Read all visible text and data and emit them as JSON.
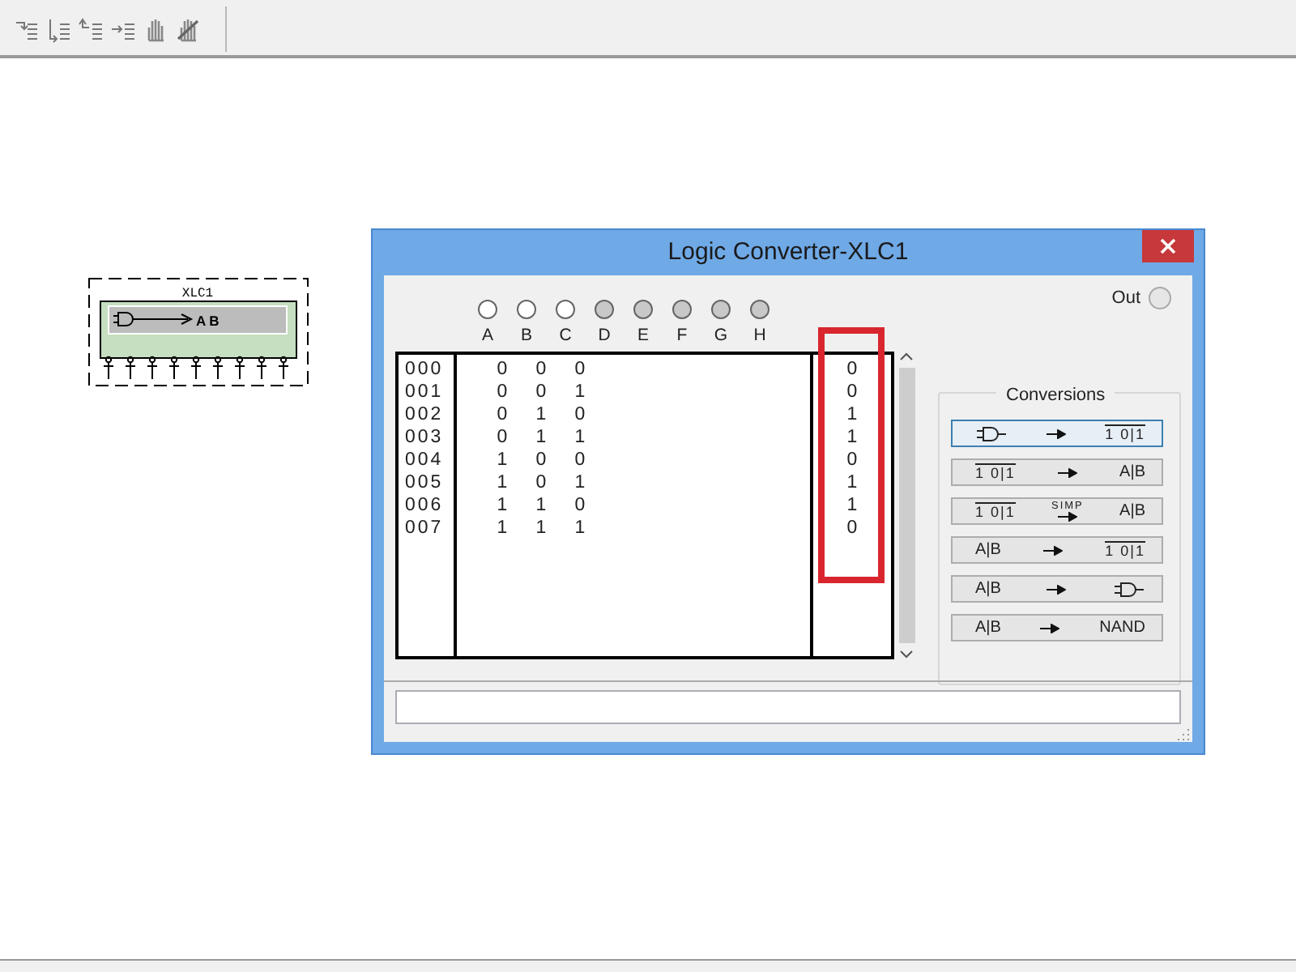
{
  "component": {
    "label": "XLC1",
    "symbol_text": "A B"
  },
  "window": {
    "title": "Logic Converter-XLC1",
    "out_label": "Out",
    "inputs": [
      {
        "label": "A",
        "active": true
      },
      {
        "label": "B",
        "active": true
      },
      {
        "label": "C",
        "active": true
      },
      {
        "label": "D",
        "active": false
      },
      {
        "label": "E",
        "active": false
      },
      {
        "label": "F",
        "active": false
      },
      {
        "label": "G",
        "active": false
      },
      {
        "label": "H",
        "active": false
      }
    ],
    "rows": [
      {
        "index": "000",
        "values": [
          "0",
          "0",
          "0"
        ],
        "output": "0"
      },
      {
        "index": "001",
        "values": [
          "0",
          "0",
          "1"
        ],
        "output": "0"
      },
      {
        "index": "002",
        "values": [
          "0",
          "1",
          "0"
        ],
        "output": "1"
      },
      {
        "index": "003",
        "values": [
          "0",
          "1",
          "1"
        ],
        "output": "1"
      },
      {
        "index": "004",
        "values": [
          "1",
          "0",
          "0"
        ],
        "output": "0"
      },
      {
        "index": "005",
        "values": [
          "1",
          "0",
          "1"
        ],
        "output": "1"
      },
      {
        "index": "006",
        "values": [
          "1",
          "1",
          "0"
        ],
        "output": "1"
      },
      {
        "index": "007",
        "values": [
          "1",
          "1",
          "1"
        ],
        "output": "0"
      }
    ],
    "output_highlighted": true,
    "conversions": {
      "title": "Conversions",
      "buttons": [
        {
          "selected": true,
          "from": {
            "kind": "gate"
          },
          "to": {
            "kind": "table",
            "text": "1 0|1"
          }
        },
        {
          "selected": false,
          "from": {
            "kind": "table",
            "text": "1 0|1"
          },
          "to": {
            "kind": "expr",
            "text": "A|B"
          }
        },
        {
          "selected": false,
          "from": {
            "kind": "table",
            "text": "1 0|1"
          },
          "arrow_label": "SIMP",
          "to": {
            "kind": "expr",
            "text": "A|B"
          }
        },
        {
          "selected": false,
          "from": {
            "kind": "expr",
            "text": "A|B"
          },
          "to": {
            "kind": "table",
            "text": "1 0|1"
          }
        },
        {
          "selected": false,
          "from": {
            "kind": "expr",
            "text": "A|B"
          },
          "to": {
            "kind": "gate"
          }
        },
        {
          "selected": false,
          "from": {
            "kind": "expr",
            "text": "A|B"
          },
          "to": {
            "kind": "expr",
            "text": "NAND"
          }
        }
      ]
    }
  }
}
